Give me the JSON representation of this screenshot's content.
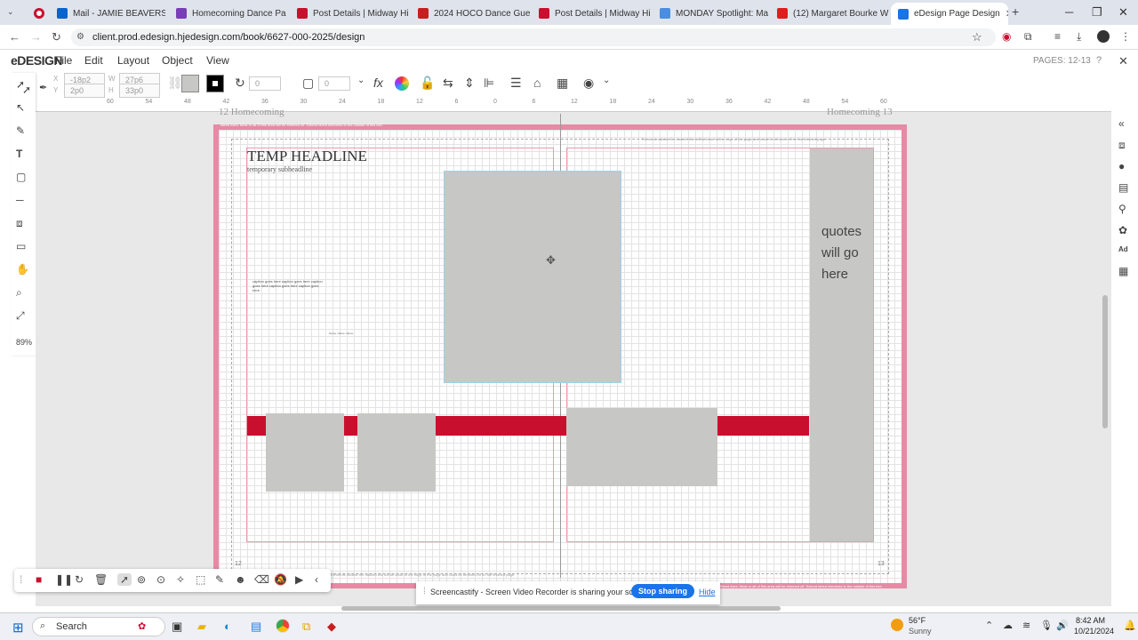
{
  "browser": {
    "tabs": [
      {
        "label": "",
        "fav": "#c8102e"
      },
      {
        "label": "Mail - JAMIE BEAVERS -",
        "fav": "#0a64c8"
      },
      {
        "label": "Homecoming Dance Pa",
        "fav": "#7a3db8"
      },
      {
        "label": "Post Details | Midway Hi",
        "fav": "#c8102e"
      },
      {
        "label": "2024 HOCO Dance Gues",
        "fav": "#c81e1e"
      },
      {
        "label": "Post Details | Midway Hi",
        "fav": "#c8102e"
      },
      {
        "label": "MONDAY Spotlight: Ma",
        "fav": "#4a8ee0"
      },
      {
        "label": "(12) Margaret Bourke W",
        "fav": "#e01e1e"
      },
      {
        "label": "eDesign Page Design",
        "fav": "#1a73e8"
      }
    ],
    "new_tab": "+",
    "url": "client.prod.edesign.hjedesign.com/book/6627-000-2025/design"
  },
  "app": {
    "logo": "eDESIGN",
    "menu": [
      "File",
      "Edit",
      "Layout",
      "Object",
      "View"
    ],
    "pages_label": "PAGES: 12-13",
    "close": "✕"
  },
  "toolbar": {
    "x_label": "X",
    "x_value": "-18p2",
    "y_label": "Y",
    "y_value": "2p0",
    "w_label": "W",
    "w_value": "27p6",
    "h_label": "H",
    "h_value": "33p0",
    "rotate_value": "0",
    "stroke_value": "0"
  },
  "ruler": [
    "60",
    "54",
    "48",
    "42",
    "36",
    "30",
    "24",
    "18",
    "12",
    "6",
    "0",
    "6",
    "12",
    "18",
    "24",
    "30",
    "36",
    "42",
    "48",
    "54",
    "60"
  ],
  "zoom": "89%",
  "spread": {
    "left_folio": "12   Homecoming",
    "right_folio": "Homecoming   13",
    "bleed_text_left": "Bleed Area: Most or all of this area will be trimmed off. Extend bleed elements to the outside of this line.",
    "bleed_text_right": "Elements outside the dashed line will be close to the edge of the page and could be trimmed off on the finished page.",
    "headline": "TEMP HEADLINE",
    "subheadline": "temporary subheadline",
    "caption": "caption goes here caption goes here caption goes here caption goes here caption goes here",
    "photo_credit": "Name, Name, Name",
    "quote": "quotes will go here",
    "page_num_left": "12",
    "page_num_right": "13",
    "bottom_text": "Elements outside the dashed line will be close to the edge of the page and could be trimmed off on the finished page.",
    "bottom_bleed": "Bleed Area: Most or all of this area will be trimmed off. Extend bleed elements to the outside of this line."
  },
  "screencastify": {
    "message": "Screencastify - Screen Video Recorder is sharing your screen.",
    "stop": "Stop sharing",
    "hide": "Hide"
  },
  "taskbar": {
    "search": "Search",
    "weather_temp": "56°F",
    "weather_desc": "Sunny",
    "time": "8:42 AM",
    "date": "10/21/2024"
  },
  "colors": {
    "accent": "#c8102e",
    "pink": "#e68aa5",
    "blue": "#1a73e8"
  }
}
